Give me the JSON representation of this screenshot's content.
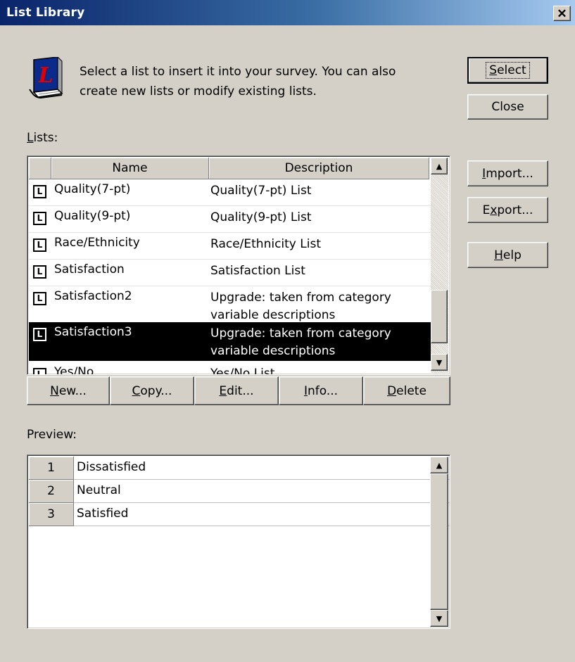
{
  "window": {
    "title": "List Library",
    "close_glyph": "✕"
  },
  "intro": {
    "icon": "book-icon",
    "icon_letter": "L",
    "line1": "Select a list to insert it into your survey. You can also",
    "line2": "create new lists or modify existing lists."
  },
  "side_buttons": {
    "select": {
      "mnemonic": "S",
      "rest": "elect"
    },
    "close": "Close",
    "import": {
      "mnemonic": "I",
      "rest": "mport..."
    },
    "export": {
      "pre": "E",
      "mnemonic": "x",
      "rest": "port..."
    },
    "help": {
      "mnemonic": "H",
      "rest": "elp"
    }
  },
  "lists": {
    "label": {
      "mnemonic": "L",
      "rest": "ists:"
    },
    "columns": {
      "name": "Name",
      "description": "Description"
    },
    "row_icon_letter": "L",
    "rows": [
      {
        "name": "Quality(7-pt)",
        "desc1": "Quality(7-pt) List",
        "desc2": ""
      },
      {
        "name": "Quality(9-pt)",
        "desc1": "Quality(9-pt) List",
        "desc2": ""
      },
      {
        "name": "Race/Ethnicity",
        "desc1": "Race/Ethnicity List",
        "desc2": ""
      },
      {
        "name": "Satisfaction",
        "desc1": "Satisfaction List",
        "desc2": ""
      },
      {
        "name": "Satisfaction2",
        "desc1": "Upgrade: taken from category",
        "desc2": "variable descriptions"
      },
      {
        "name": "Satisfaction3",
        "desc1": "Upgrade: taken from category",
        "desc2": "variable descriptions",
        "selected": true
      },
      {
        "name": "Yes/No",
        "desc1": "Yes/No List",
        "desc2": ""
      }
    ],
    "scroll_up_glyph": "▲",
    "scroll_down_glyph": "▼"
  },
  "list_buttons": {
    "new": {
      "mnemonic": "N",
      "rest": "ew..."
    },
    "copy": {
      "mnemonic": "C",
      "rest": "opy..."
    },
    "edit": {
      "mnemonic": "E",
      "rest": "dit..."
    },
    "info": {
      "mnemonic": "I",
      "rest": "nfo..."
    },
    "delete": {
      "mnemonic": "D",
      "rest": "elete"
    }
  },
  "preview": {
    "label": "Preview:",
    "rows": [
      {
        "num": "1",
        "value": "Dissatisfied"
      },
      {
        "num": "2",
        "value": "Neutral"
      },
      {
        "num": "3",
        "value": "Satisfied"
      }
    ]
  },
  "colors": {
    "face": "#d4d0c8",
    "title_start": "#0a246a",
    "title_end": "#a6caf0",
    "selection": "#000000"
  }
}
